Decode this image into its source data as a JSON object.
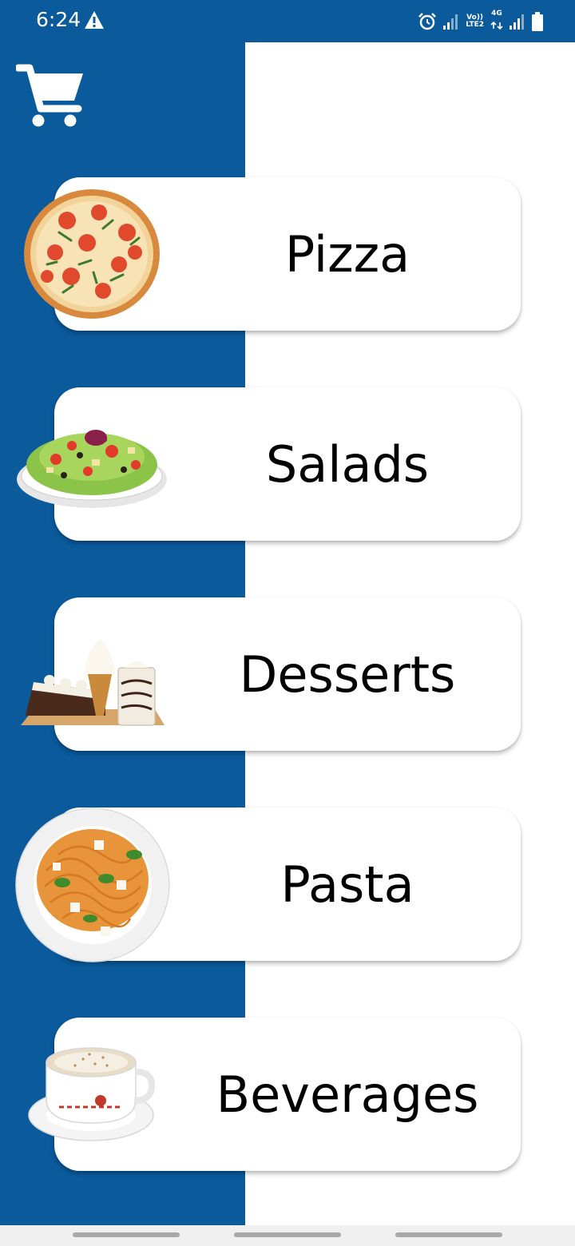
{
  "status_bar": {
    "time": "6:24",
    "warning_icon": "warning-triangle-icon",
    "alarm_icon": "alarm-clock-icon",
    "network_vo": "Vo))",
    "network_lte": "LTE2",
    "network_4g": "4G",
    "battery_icon": "battery-icon"
  },
  "header": {
    "cart_icon": "shopping-cart-icon"
  },
  "categories": [
    {
      "label": "Pizza",
      "image": "pizza"
    },
    {
      "label": "Salads",
      "image": "salad-bowl"
    },
    {
      "label": "Desserts",
      "image": "desserts-ice-cream-pie"
    },
    {
      "label": "Pasta",
      "image": "spaghetti-plate"
    },
    {
      "label": "Beverages",
      "image": "cappuccino-cup"
    }
  ],
  "theme": {
    "primary": "#0a5a9c",
    "card_background": "#ffffff",
    "text": "#000000"
  }
}
